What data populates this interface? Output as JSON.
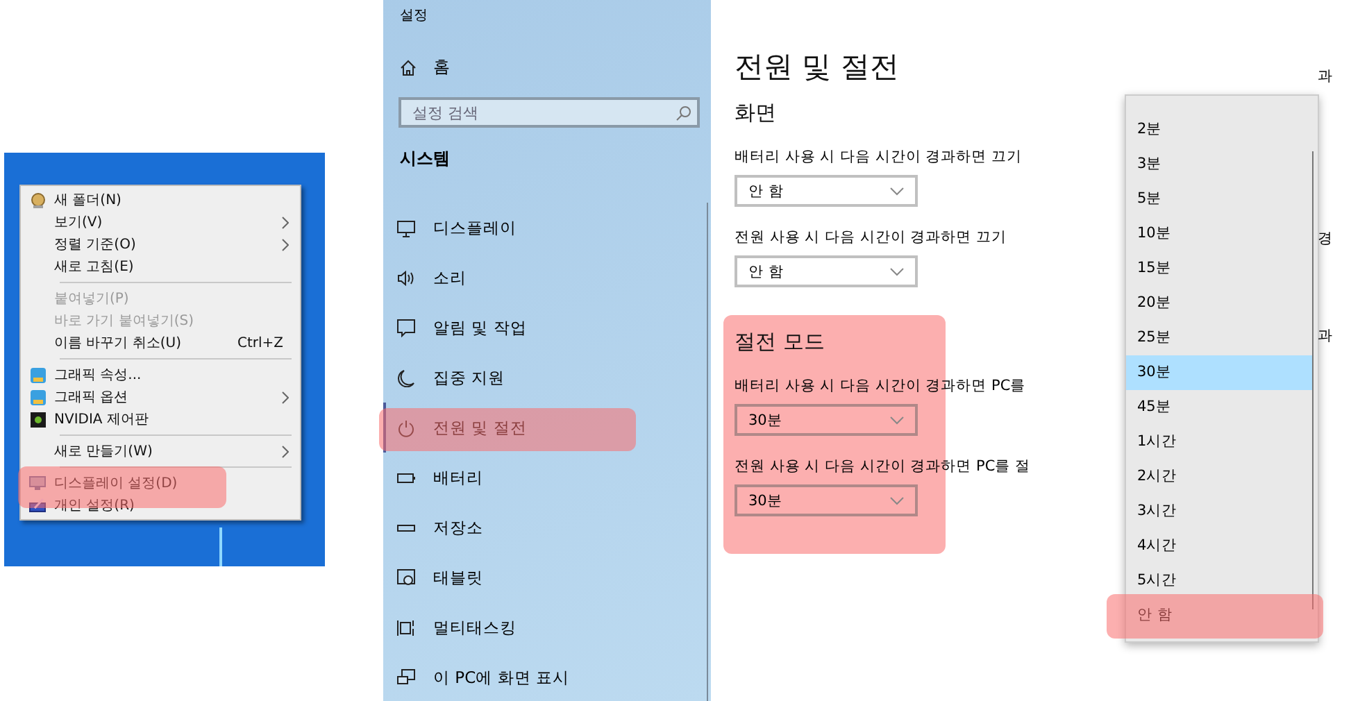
{
  "context_menu": {
    "groups": [
      {
        "items": [
          {
            "label": "새 폴더(N)",
            "disabled": false,
            "submenu": false,
            "highlighted": false
          },
          {
            "label": "보기(V)",
            "disabled": false,
            "submenu": true,
            "highlighted": false
          },
          {
            "label": "정렬 기준(O)",
            "disabled": false,
            "submenu": true,
            "highlighted": false
          },
          {
            "label": "새로 고침(E)",
            "disabled": false,
            "submenu": false,
            "highlighted": false
          }
        ]
      },
      {
        "items": [
          {
            "label": "붙여넣기(P)",
            "disabled": true,
            "submenu": false,
            "highlighted": false
          },
          {
            "label": "바로 가기 붙여넣기(S)",
            "disabled": true,
            "submenu": false,
            "highlighted": false
          },
          {
            "label": "이름 바꾸기 취소(U)",
            "shortcut": "Ctrl+Z",
            "disabled": false,
            "submenu": false,
            "highlighted": false
          }
        ]
      },
      {
        "items": [
          {
            "label": "그래픽 속성...",
            "disabled": false,
            "submenu": false,
            "highlighted": false
          },
          {
            "label": "그래픽 옵션",
            "disabled": false,
            "submenu": true,
            "highlighted": false
          },
          {
            "label": "NVIDIA 제어판",
            "disabled": false,
            "submenu": false,
            "highlighted": false
          }
        ]
      },
      {
        "items": [
          {
            "label": "새로 만들기(W)",
            "disabled": false,
            "submenu": true,
            "highlighted": false
          }
        ]
      },
      {
        "items": [
          {
            "label": "디스플레이 설정(D)",
            "disabled": false,
            "submenu": false,
            "highlighted": true
          },
          {
            "label": "개인 설정(R)",
            "disabled": false,
            "submenu": false,
            "highlighted": false
          }
        ]
      }
    ]
  },
  "settings": {
    "window_title": "설정",
    "home": "홈",
    "search": {
      "placeholder": "설정 검색"
    },
    "category": "시스템",
    "nav_items": [
      {
        "label": "디스플레이",
        "selected": false,
        "highlighted": false
      },
      {
        "label": "소리",
        "selected": false,
        "highlighted": false
      },
      {
        "label": "알림 및 작업",
        "selected": false,
        "highlighted": false
      },
      {
        "label": "집중 지원",
        "selected": false,
        "highlighted": false
      },
      {
        "label": "전원 및 절전",
        "selected": true,
        "highlighted": true
      },
      {
        "label": "배터리",
        "selected": false,
        "highlighted": false
      },
      {
        "label": "저장소",
        "selected": false,
        "highlighted": false
      },
      {
        "label": "태블릿",
        "selected": false,
        "highlighted": false
      },
      {
        "label": "멀티태스킹",
        "selected": false,
        "highlighted": false
      },
      {
        "label": "이 PC에 화면 표시",
        "selected": false,
        "highlighted": false
      }
    ]
  },
  "page": {
    "title": "전원 및 절전",
    "sections": [
      {
        "heading": "화면",
        "highlighted": false,
        "settings": [
          {
            "label": "배터리 사용 시 다음 시간이 경과하면 끄기",
            "value": "안 함"
          },
          {
            "label": "전원 사용 시 다음 시간이 경과하면 끄기",
            "value": "안 함"
          }
        ]
      },
      {
        "heading": "절전 모드",
        "highlighted": true,
        "settings": [
          {
            "label": "배터리 사용 시 다음 시간이 경과하면 PC를",
            "value": "30분"
          },
          {
            "label": "전원 사용 시 다음 시간이 경과하면 PC를 절",
            "value": "30분"
          }
        ]
      }
    ]
  },
  "dropdown_list": {
    "options": [
      {
        "label": "2분",
        "selected": false,
        "highlighted": false
      },
      {
        "label": "3분",
        "selected": false,
        "highlighted": false
      },
      {
        "label": "5분",
        "selected": false,
        "highlighted": false
      },
      {
        "label": "10분",
        "selected": false,
        "highlighted": false
      },
      {
        "label": "15분",
        "selected": false,
        "highlighted": false
      },
      {
        "label": "20분",
        "selected": false,
        "highlighted": false
      },
      {
        "label": "25분",
        "selected": false,
        "highlighted": false
      },
      {
        "label": "30분",
        "selected": true,
        "highlighted": false
      },
      {
        "label": "45분",
        "selected": false,
        "highlighted": false
      },
      {
        "label": "1시간",
        "selected": false,
        "highlighted": false
      },
      {
        "label": "2시간",
        "selected": false,
        "highlighted": false
      },
      {
        "label": "3시간",
        "selected": false,
        "highlighted": false
      },
      {
        "label": "4시간",
        "selected": false,
        "highlighted": false
      },
      {
        "label": "5시간",
        "selected": false,
        "highlighted": false
      },
      {
        "label": "안 함",
        "selected": false,
        "highlighted": true
      }
    ],
    "background_fragments": [
      "과",
      "경",
      "과"
    ]
  }
}
